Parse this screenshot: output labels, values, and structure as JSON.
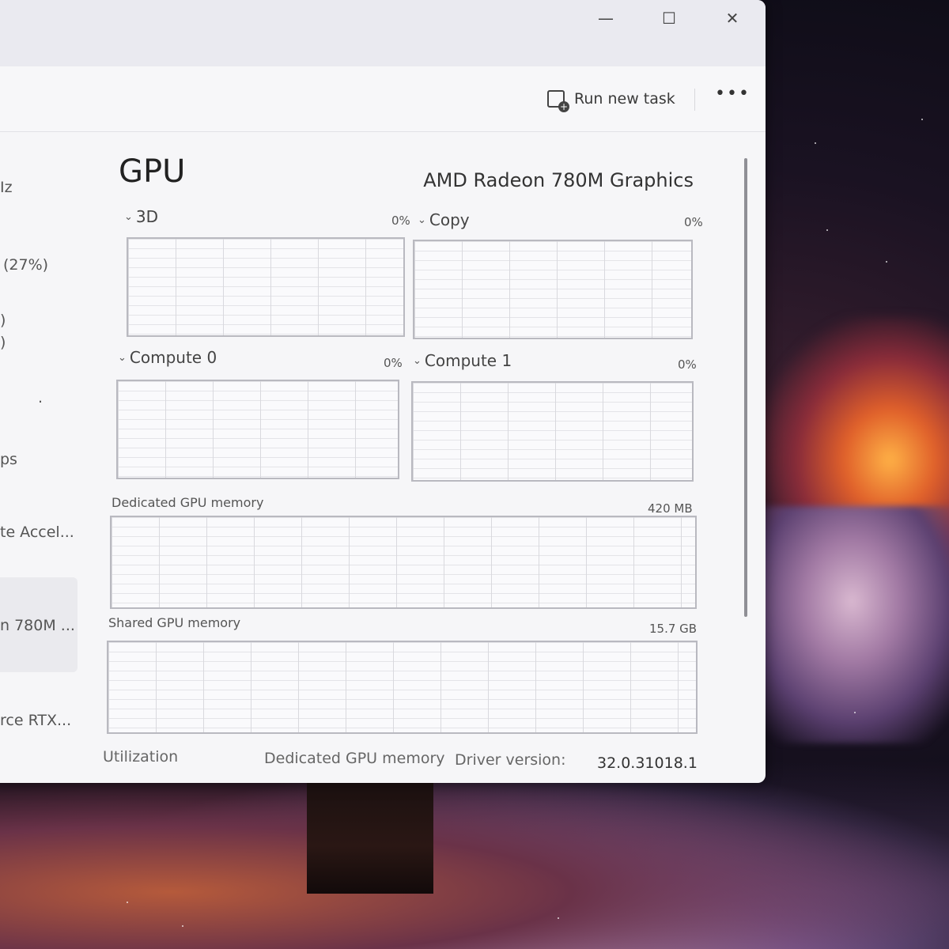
{
  "window_controls": {
    "minimize": "—",
    "maximize": "☐",
    "close": "✕"
  },
  "toolbar": {
    "run_new_task": "Run new task",
    "more": "•••"
  },
  "sidebar": {
    "fragments": [
      "Iz",
      "(27%)",
      ")",
      ")",
      ".",
      "ps",
      "te Accel...",
      "n 780M ...",
      "rce RTX..."
    ]
  },
  "gpu": {
    "title": "GPU",
    "device_name": "AMD Radeon 780M Graphics",
    "engines": [
      {
        "label": "3D",
        "percent": "0%"
      },
      {
        "label": "Copy",
        "percent": "0%"
      },
      {
        "label": "Compute 0",
        "percent": "0%"
      },
      {
        "label": "Compute 1",
        "percent": "0%"
      }
    ],
    "dedicated_memory": {
      "label": "Dedicated GPU memory",
      "value": "420 MB"
    },
    "shared_memory": {
      "label": "Shared GPU memory",
      "value": "15.7 GB"
    },
    "stats": {
      "utilization_label": "Utilization",
      "dedicated_label": "Dedicated GPU memory",
      "driver_label": "Driver version:",
      "driver_value": "32.0.31018.1"
    }
  }
}
